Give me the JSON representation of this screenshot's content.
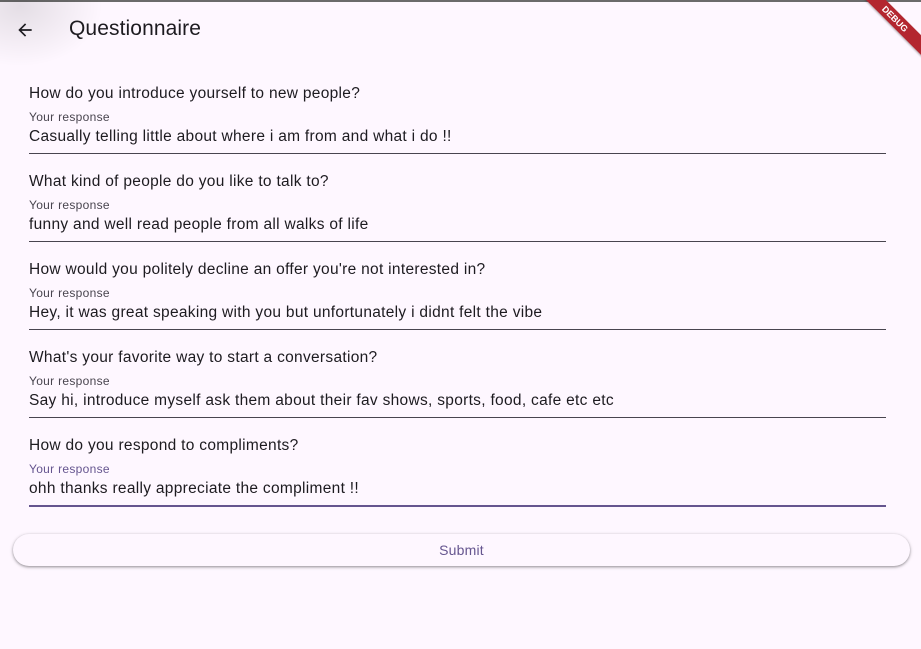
{
  "appbar": {
    "title": "Questionnaire",
    "back_icon": "arrow-back-icon"
  },
  "debug_banner": "DEBUG",
  "form": {
    "response_label": "Your response",
    "questions": [
      {
        "question": "How do you introduce yourself to new people?",
        "response": "Casually telling little about where i am from and what i do !!"
      },
      {
        "question": "What kind of people do you like to talk to?",
        "response": "funny and well read people from all walks of life"
      },
      {
        "question": "How would you politely decline an offer you're not interested in?",
        "response": "Hey, it was great speaking with you but unfortunately i didnt felt the vibe"
      },
      {
        "question": "What's your favorite way to start a conversation?",
        "response": "Say hi, introduce myself ask them about their fav shows, sports, food, cafe etc etc"
      },
      {
        "question": "How do you respond to compliments?",
        "response": "ohh thanks really appreciate the compliment !!"
      }
    ]
  },
  "submit_label": "Submit",
  "colors": {
    "background": "#fef7ff",
    "primary": "#65558f",
    "text": "#1d1b20",
    "debug_ribbon": "#b3262f"
  }
}
